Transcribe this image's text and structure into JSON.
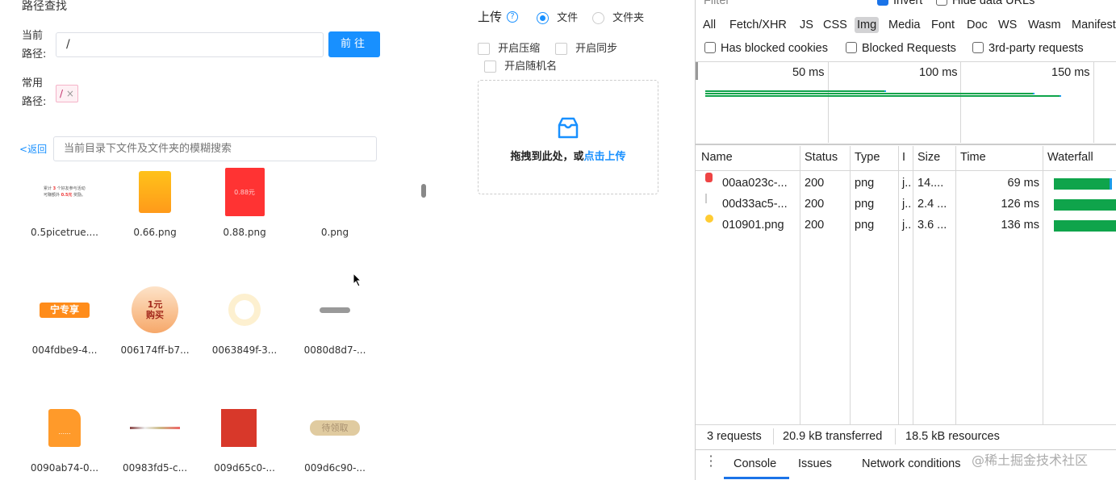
{
  "path_finder": {
    "title": "路径查找",
    "current_path_label": "当前路径:",
    "current_path_value": "/",
    "go_button": "前往",
    "common_path_label": "常用路径:",
    "common_path_tags": [
      "/"
    ],
    "back_label": "返回",
    "search_placeholder": "当前目录下文件及文件夹的模糊搜索"
  },
  "files": [
    {
      "name": "0.5picetrue....",
      "thumb": "text-banner"
    },
    {
      "name": "0.66.png",
      "thumb": "orange-envelope"
    },
    {
      "name": "0.88.png",
      "thumb": "red-envelope"
    },
    {
      "name": "0.png",
      "thumb": "blank"
    },
    {
      "name": "004fdbe9-4...",
      "thumb": "orange-badge"
    },
    {
      "name": "006174ff-b7...",
      "thumb": "circle-button"
    },
    {
      "name": "0063849f-3...",
      "thumb": "sun-ring"
    },
    {
      "name": "0080d8d7-...",
      "thumb": "grey-pill"
    },
    {
      "name": "0090ab74-0...",
      "thumb": "orange-file"
    },
    {
      "name": "00983fd5-c...",
      "thumb": "thin-strip"
    },
    {
      "name": "009d65c0-...",
      "thumb": "poster"
    },
    {
      "name": "009d6c90-...",
      "thumb": "gold-button"
    }
  ],
  "thumb_text": {
    "orange_badge": "宁专享",
    "circle_line1": "1元",
    "circle_line2": "购买",
    "gold_button": "待领取",
    "red_envelope": "0.88元"
  },
  "upload": {
    "title": "上传",
    "radio_file": "文件",
    "radio_folder": "文件夹",
    "selected": "文件",
    "opt_compress": "开启压缩",
    "opt_sync": "开启同步",
    "opt_random": "开启随机名",
    "drop_text": "拖拽到此处，或",
    "drop_link": "点击上传"
  },
  "devtools": {
    "filter_label": "Filter",
    "invert_label": "Invert",
    "invert_checked": true,
    "hide_data_urls": "Hide data URLs",
    "type_tabs": [
      "All",
      "Fetch/XHR",
      "JS",
      "CSS",
      "Img",
      "Media",
      "Font",
      "Doc",
      "WS",
      "Wasm",
      "Manifest"
    ],
    "active_tab": "Img",
    "checkboxes": [
      "Has blocked cookies",
      "Blocked Requests",
      "3rd-party requests"
    ],
    "overview_ticks": [
      "50 ms",
      "100 ms",
      "150 ms"
    ],
    "columns": [
      "Name",
      "Status",
      "Type",
      "I",
      "Size",
      "Time",
      "Waterfall"
    ],
    "rows": [
      {
        "name": "00aa023c-...",
        "status": "200",
        "type": "png",
        "initiator": "j..",
        "size": "14....",
        "time": "69 ms",
        "time_ms": 69
      },
      {
        "name": "00d33ac5-...",
        "status": "200",
        "type": "png",
        "initiator": "j..",
        "size": "2.4 ...",
        "time": "126 ms",
        "time_ms": 126
      },
      {
        "name": "010901.png",
        "status": "200",
        "type": "png",
        "initiator": "j..",
        "size": "3.6 ...",
        "time": "136 ms",
        "time_ms": 136
      }
    ],
    "summary": [
      "3 requests",
      "20.9 kB transferred",
      "18.5 kB resources"
    ],
    "drawer_tabs": [
      "Console",
      "Issues",
      "Network conditions"
    ],
    "active_drawer_tab": "Console",
    "colors": {
      "accent": "#1890ff",
      "waterfall": "#0fa44b",
      "selected_tab": "#d2d2d4"
    }
  },
  "watermark": "@稀土掘金技术社区"
}
